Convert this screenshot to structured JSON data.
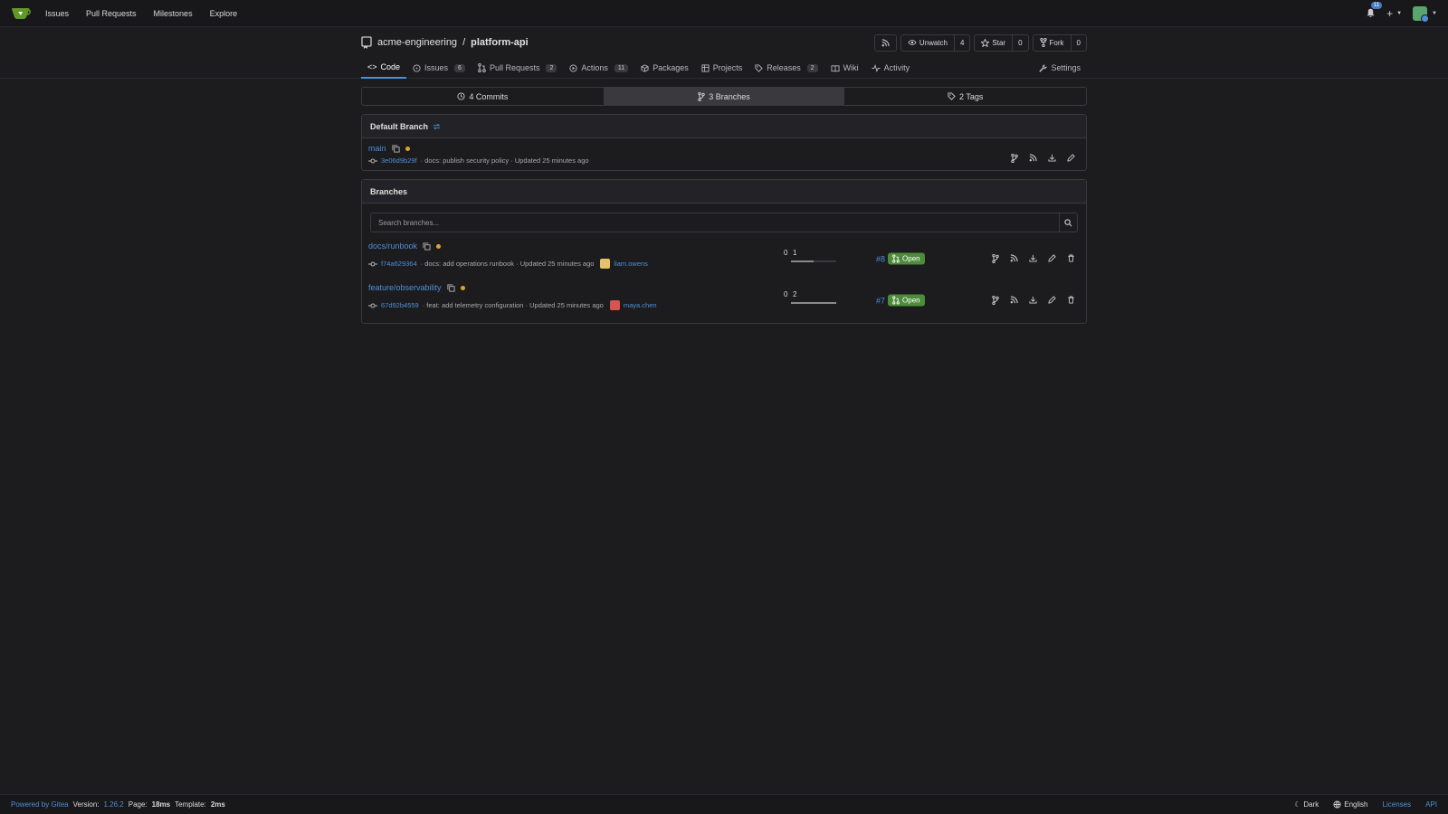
{
  "nav": {
    "items": [
      "Issues",
      "Pull Requests",
      "Milestones",
      "Explore"
    ],
    "notification_count": "11",
    "plus_label": "+"
  },
  "repo": {
    "owner": "acme-engineering",
    "separator": "/",
    "name": "platform-api",
    "unwatch_label": "Unwatch",
    "watch_count": "4",
    "star_label": "Star",
    "star_count": "0",
    "fork_label": "Fork",
    "fork_count": "0"
  },
  "tabs": [
    {
      "label": "Code",
      "icon": "code-icon",
      "badge": ""
    },
    {
      "label": "Issues",
      "icon": "issue-icon",
      "badge": "6"
    },
    {
      "label": "Pull Requests",
      "icon": "pull-request-icon",
      "badge": "2"
    },
    {
      "label": "Actions",
      "icon": "play-icon",
      "badge": "11"
    },
    {
      "label": "Packages",
      "icon": "package-icon",
      "badge": ""
    },
    {
      "label": "Projects",
      "icon": "project-icon",
      "badge": ""
    },
    {
      "label": "Releases",
      "icon": "tag-icon",
      "badge": "2"
    },
    {
      "label": "Wiki",
      "icon": "book-icon",
      "badge": ""
    },
    {
      "label": "Activity",
      "icon": "pulse-icon",
      "badge": ""
    },
    {
      "label": "Settings",
      "icon": "wrench-icon",
      "badge": ""
    }
  ],
  "stats": {
    "commits": "4 Commits",
    "branches": "3 Branches",
    "tags": "2 Tags"
  },
  "default_branch": {
    "heading": "Default Branch",
    "name": "main",
    "sha": "3e06d9b29f",
    "message": "· docs: publish security policy · Updated 25 minutes ago"
  },
  "branches": {
    "heading": "Branches",
    "search_placeholder": "Search branches...",
    "rows": [
      {
        "name": "docs/runbook",
        "sha": "f74a629364",
        "message": "· docs: add operations runbook · Updated 25 minutes ago",
        "author": "liam.owens",
        "behind": "0",
        "ahead": "1",
        "ahead_fraction": 0.5,
        "pr_number": "#8",
        "pr_status": "Open",
        "avatar_color": "#e6c26a"
      },
      {
        "name": "feature/observability",
        "sha": "67d92b4559",
        "message": "· feat: add telemetry configuration · Updated 25 minutes ago",
        "author": "maya.chen",
        "behind": "0",
        "ahead": "2",
        "ahead_fraction": 1.0,
        "pr_number": "#7",
        "pr_status": "Open",
        "avatar_color": "#d9534f"
      }
    ]
  },
  "footer": {
    "powered": "Powered by Gitea",
    "version_label": "Version:",
    "version": "1.26.2",
    "page_label": "Page:",
    "page_time": "18ms",
    "template_label": "Template:",
    "template_time": "2ms",
    "theme": "Dark",
    "language": "English",
    "licenses": "Licenses",
    "api": "API"
  },
  "colors": {
    "accent": "#4c8fd6",
    "open_badge": "#4d8c3a",
    "dot": "#d8a72c",
    "background": "#1c1c1f"
  }
}
